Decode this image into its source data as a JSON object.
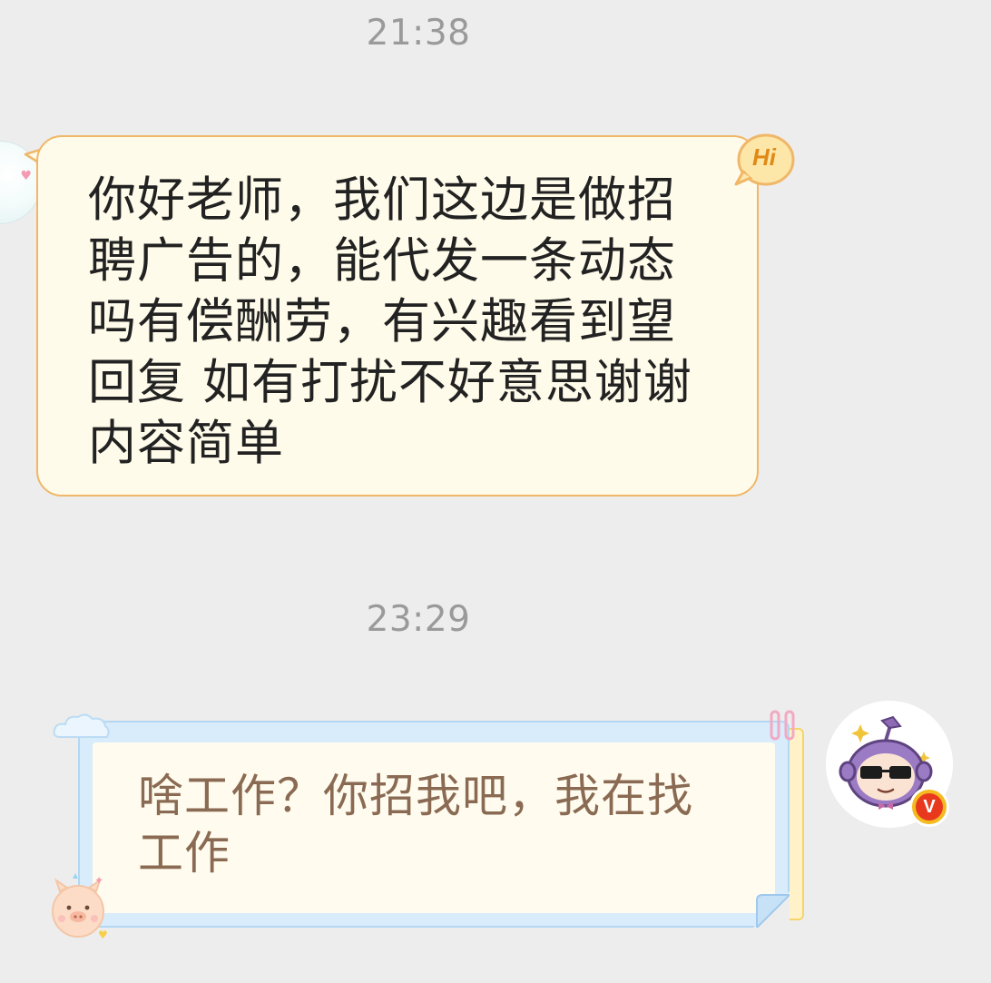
{
  "chat": {
    "timestamps": [
      "21:38",
      "23:29"
    ],
    "incoming": {
      "badge": "Hi",
      "text": "你好老师，我们这边是做招聘广告的，能代发一条动态吗有偿酬劳，有兴趣看到望回复 如有打扰不好意思谢谢内容简单",
      "lines": [
        "你好老师，我们这边是做招",
        "聘广告的，能代发一条动态",
        "吗有偿酬劳，有兴趣看到望",
        "回复 如有打扰不好意思谢谢",
        "内容简单"
      ]
    },
    "outgoing": {
      "text": "啥工作？你招我吧，我在找工作",
      "lines": [
        "啥工作？你招我吧，我在找",
        "工作"
      ],
      "vip_badge": "V"
    }
  },
  "colors": {
    "background": "#ededed",
    "incoming_bubble_fill": "#fffbea",
    "incoming_bubble_border": "#f0b769",
    "outgoing_bubble_frame": "#d8ecfb",
    "outgoing_text": "#8a6a52",
    "timestamp_text": "#9a9a9a"
  },
  "icons": {
    "hi_badge": "hi-speech-bubble-icon",
    "left_avatar": "contact-avatar",
    "right_avatar": "sunglasses-character-avatar",
    "vip": "vip-badge-icon",
    "decorations": [
      "cloud-icon",
      "paper-clip-icon",
      "pig-sticker-icon",
      "page-fold-icon"
    ]
  }
}
